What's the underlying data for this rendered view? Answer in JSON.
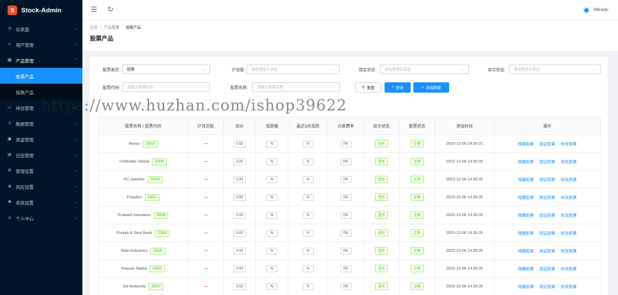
{
  "app": {
    "title": "Stock-Admin",
    "logo_glyph": "S"
  },
  "header": {
    "user_name": "Mitrade"
  },
  "sidebar": {
    "items": [
      {
        "label": "仪表盘",
        "icon": "dashboard-icon"
      },
      {
        "label": "用户管理",
        "icon": "user-icon"
      },
      {
        "label": "产品管理",
        "icon": "chart-icon",
        "open": true,
        "children": [
          {
            "label": "股票产品",
            "active": true
          },
          {
            "label": "指数产品"
          }
        ]
      },
      {
        "label": "持仓管理",
        "icon": "briefcase-icon"
      },
      {
        "label": "数据管理",
        "icon": "database-icon"
      },
      {
        "label": "资金管理",
        "icon": "wallet-icon"
      },
      {
        "label": "日志管理",
        "icon": "log-icon"
      },
      {
        "label": "管理设置",
        "icon": "settings-icon"
      },
      {
        "label": "风控设置",
        "icon": "shield-icon"
      },
      {
        "label": "系统设置",
        "icon": "gear-icon"
      },
      {
        "label": "个人中心",
        "icon": "person-icon"
      }
    ]
  },
  "breadcrumb": [
    "主页",
    "产品管理",
    "股票产品"
  ],
  "page_title": "股票产品",
  "filters": {
    "stock_type": {
      "label": "股票类型:",
      "value": "股票"
    },
    "market": {
      "label": "沪深股:",
      "placeholder": "请选择显示状态"
    },
    "lock_status": {
      "label": "锁定状态:",
      "placeholder": "请选择锁定状态"
    },
    "display_status": {
      "label": "显示状态:",
      "placeholder": "请选择显示状态"
    },
    "stock_code": {
      "label": "股票代码:",
      "placeholder": "请输入股票代码"
    },
    "stock_name": {
      "label": "股票名称:",
      "placeholder": "请输入股票名称"
    }
  },
  "buttons": {
    "reset": "重置",
    "search": "查询",
    "add": "添加股票"
  },
  "table": {
    "headers": [
      "股票名称 / 股票代码",
      "沪深京股",
      "现价",
      "涨跌幅",
      "最近3天涨跌",
      "点差费率",
      "显示状态",
      "股票状态",
      "添加时间",
      "操作"
    ],
    "rows": [
      {
        "name": "Nesco",
        "code": "39894",
        "price": "0.00",
        "change": "%",
        "change3": "%",
        "spread": "0%",
        "display": "显示",
        "status": "正常",
        "time": "2023-12-06 14:39:21"
      },
      {
        "name": "OnMobile Global",
        "code": "39895",
        "price": "0.00",
        "change": "%",
        "change3": "%",
        "spread": "0%",
        "display": "显示",
        "status": "正常",
        "time": "2023-12-06 14:39:25"
      },
      {
        "name": "PC Jeweller",
        "code": "39896",
        "price": "0.00",
        "change": "%",
        "change3": "%",
        "spread": "0%",
        "display": "显示",
        "status": "正常",
        "time": "2023-12-06 14:39:25"
      },
      {
        "name": "Polyplex",
        "code": "39897",
        "price": "0.00",
        "change": "%",
        "change3": "%",
        "spread": "0%",
        "display": "显示",
        "status": "正常",
        "time": "2023-12-06 14:39:25"
      },
      {
        "name": "Prakash Industries",
        "code": "39898",
        "price": "0.00",
        "change": "%",
        "change3": "%",
        "spread": "0%",
        "display": "显示",
        "status": "正常",
        "time": "2023-12-06 14:39:25"
      },
      {
        "name": "Punjab & Sind Bank",
        "code": "39899",
        "price": "0.00",
        "change": "%",
        "change3": "%",
        "spread": "0%",
        "display": "显示",
        "status": "正常",
        "time": "2023-12-06 14:39:25"
      },
      {
        "name": "Rain Industries",
        "code": "39900",
        "price": "0.00",
        "change": "%",
        "change3": "%",
        "spread": "0%",
        "display": "显示",
        "status": "正常",
        "time": "2023-12-06 14:39:25"
      },
      {
        "name": "Paisalo Digital",
        "code": "39903",
        "price": "0.00",
        "change": "%",
        "change3": "%",
        "spread": "0%",
        "display": "显示",
        "status": "正常",
        "time": "2023-12-06 14:39:25"
      },
      {
        "name": "Siti Networks",
        "code": "39907",
        "price": "0.00",
        "change": "%",
        "change3": "%",
        "spread": "0%",
        "display": "显示",
        "status": "正常",
        "time": "2023-12-06 14:39:25"
      }
    ],
    "actions": [
      "隐藏股票",
      "锁定股票",
      "修改股票"
    ]
  },
  "watermark": "https://www.huzhan.com/ishop39622",
  "colors": {
    "sidebar_bg": "#001529",
    "primary": "#1890ff",
    "success": "#52c41a",
    "danger": "#e4393c"
  }
}
